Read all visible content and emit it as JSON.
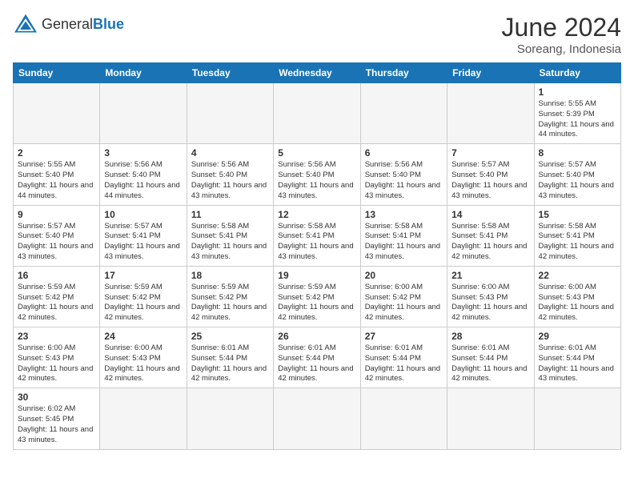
{
  "header": {
    "logo_general": "General",
    "logo_blue": "Blue",
    "month_year": "June 2024",
    "location": "Soreang, Indonesia"
  },
  "days_of_week": [
    "Sunday",
    "Monday",
    "Tuesday",
    "Wednesday",
    "Thursday",
    "Friday",
    "Saturday"
  ],
  "weeks": [
    [
      {
        "day": "",
        "info": ""
      },
      {
        "day": "",
        "info": ""
      },
      {
        "day": "",
        "info": ""
      },
      {
        "day": "",
        "info": ""
      },
      {
        "day": "",
        "info": ""
      },
      {
        "day": "",
        "info": ""
      },
      {
        "day": "1",
        "info": "Sunrise: 5:55 AM\nSunset: 5:39 PM\nDaylight: 11 hours and 44 minutes."
      }
    ],
    [
      {
        "day": "2",
        "info": "Sunrise: 5:55 AM\nSunset: 5:40 PM\nDaylight: 11 hours and 44 minutes."
      },
      {
        "day": "3",
        "info": "Sunrise: 5:56 AM\nSunset: 5:40 PM\nDaylight: 11 hours and 44 minutes."
      },
      {
        "day": "4",
        "info": "Sunrise: 5:56 AM\nSunset: 5:40 PM\nDaylight: 11 hours and 43 minutes."
      },
      {
        "day": "5",
        "info": "Sunrise: 5:56 AM\nSunset: 5:40 PM\nDaylight: 11 hours and 43 minutes."
      },
      {
        "day": "6",
        "info": "Sunrise: 5:56 AM\nSunset: 5:40 PM\nDaylight: 11 hours and 43 minutes."
      },
      {
        "day": "7",
        "info": "Sunrise: 5:57 AM\nSunset: 5:40 PM\nDaylight: 11 hours and 43 minutes."
      },
      {
        "day": "8",
        "info": "Sunrise: 5:57 AM\nSunset: 5:40 PM\nDaylight: 11 hours and 43 minutes."
      }
    ],
    [
      {
        "day": "9",
        "info": "Sunrise: 5:57 AM\nSunset: 5:40 PM\nDaylight: 11 hours and 43 minutes."
      },
      {
        "day": "10",
        "info": "Sunrise: 5:57 AM\nSunset: 5:41 PM\nDaylight: 11 hours and 43 minutes."
      },
      {
        "day": "11",
        "info": "Sunrise: 5:58 AM\nSunset: 5:41 PM\nDaylight: 11 hours and 43 minutes."
      },
      {
        "day": "12",
        "info": "Sunrise: 5:58 AM\nSunset: 5:41 PM\nDaylight: 11 hours and 43 minutes."
      },
      {
        "day": "13",
        "info": "Sunrise: 5:58 AM\nSunset: 5:41 PM\nDaylight: 11 hours and 43 minutes."
      },
      {
        "day": "14",
        "info": "Sunrise: 5:58 AM\nSunset: 5:41 PM\nDaylight: 11 hours and 42 minutes."
      },
      {
        "day": "15",
        "info": "Sunrise: 5:58 AM\nSunset: 5:41 PM\nDaylight: 11 hours and 42 minutes."
      }
    ],
    [
      {
        "day": "16",
        "info": "Sunrise: 5:59 AM\nSunset: 5:42 PM\nDaylight: 11 hours and 42 minutes."
      },
      {
        "day": "17",
        "info": "Sunrise: 5:59 AM\nSunset: 5:42 PM\nDaylight: 11 hours and 42 minutes."
      },
      {
        "day": "18",
        "info": "Sunrise: 5:59 AM\nSunset: 5:42 PM\nDaylight: 11 hours and 42 minutes."
      },
      {
        "day": "19",
        "info": "Sunrise: 5:59 AM\nSunset: 5:42 PM\nDaylight: 11 hours and 42 minutes."
      },
      {
        "day": "20",
        "info": "Sunrise: 6:00 AM\nSunset: 5:42 PM\nDaylight: 11 hours and 42 minutes."
      },
      {
        "day": "21",
        "info": "Sunrise: 6:00 AM\nSunset: 5:43 PM\nDaylight: 11 hours and 42 minutes."
      },
      {
        "day": "22",
        "info": "Sunrise: 6:00 AM\nSunset: 5:43 PM\nDaylight: 11 hours and 42 minutes."
      }
    ],
    [
      {
        "day": "23",
        "info": "Sunrise: 6:00 AM\nSunset: 5:43 PM\nDaylight: 11 hours and 42 minutes."
      },
      {
        "day": "24",
        "info": "Sunrise: 6:00 AM\nSunset: 5:43 PM\nDaylight: 11 hours and 42 minutes."
      },
      {
        "day": "25",
        "info": "Sunrise: 6:01 AM\nSunset: 5:44 PM\nDaylight: 11 hours and 42 minutes."
      },
      {
        "day": "26",
        "info": "Sunrise: 6:01 AM\nSunset: 5:44 PM\nDaylight: 11 hours and 42 minutes."
      },
      {
        "day": "27",
        "info": "Sunrise: 6:01 AM\nSunset: 5:44 PM\nDaylight: 11 hours and 42 minutes."
      },
      {
        "day": "28",
        "info": "Sunrise: 6:01 AM\nSunset: 5:44 PM\nDaylight: 11 hours and 42 minutes."
      },
      {
        "day": "29",
        "info": "Sunrise: 6:01 AM\nSunset: 5:44 PM\nDaylight: 11 hours and 43 minutes."
      }
    ],
    [
      {
        "day": "30",
        "info": "Sunrise: 6:02 AM\nSunset: 5:45 PM\nDaylight: 11 hours and 43 minutes."
      },
      {
        "day": "",
        "info": ""
      },
      {
        "day": "",
        "info": ""
      },
      {
        "day": "",
        "info": ""
      },
      {
        "day": "",
        "info": ""
      },
      {
        "day": "",
        "info": ""
      },
      {
        "day": "",
        "info": ""
      }
    ]
  ]
}
